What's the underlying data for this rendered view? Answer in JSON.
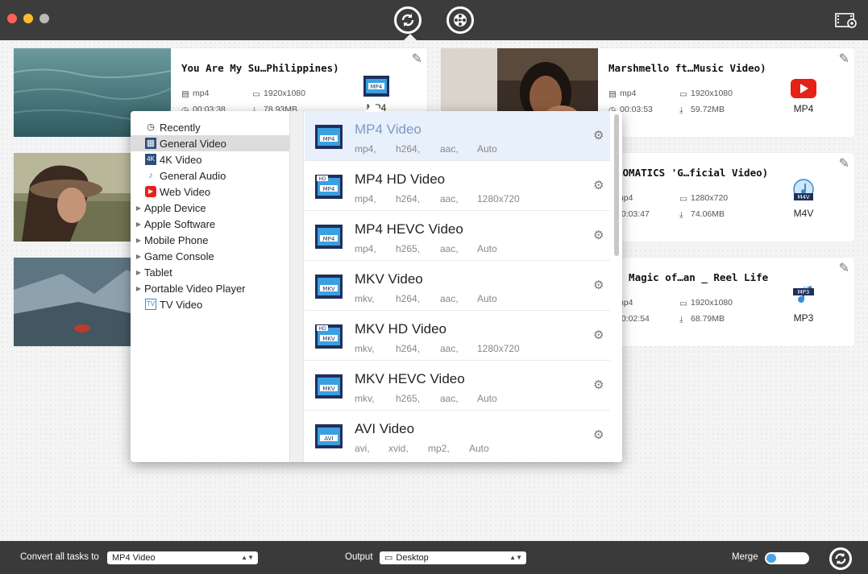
{
  "toolbar": {
    "convert_icon": "convert-refresh-icon",
    "media_icon": "film-reel-icon",
    "settings_icon": "film-settings-icon"
  },
  "tasks": [
    {
      "title": "You Are My Su…Philippines)",
      "container": "mp4",
      "resolution": "1920x1080",
      "duration": "00:03:38",
      "size": "78.93MB",
      "target_format": "MP4",
      "target_icon": "mp4-film-icon"
    },
    {
      "title": "Marshmello ft…Music Video)",
      "container": "mp4",
      "resolution": "1920x1080",
      "duration": "00:03:53",
      "size": "59.72MB",
      "target_format": "MP4",
      "target_icon": "youtube-icon"
    },
    {
      "title": "ROMATICS 'G…ficial Video)",
      "container": "mp4",
      "resolution": "1280x720",
      "duration": "00:03:47",
      "size": "74.06MB",
      "target_format": "M4V",
      "target_icon": "m4v-itunes-icon"
    },
    {
      "title": "e Magic of…an _ Reel Life",
      "container": "mp4",
      "resolution": "1920x1080",
      "duration": "00:02:54",
      "size": "68.79MB",
      "target_format": "MP3",
      "target_icon": "mp3-music-icon"
    }
  ],
  "categories": [
    {
      "label": "Recently",
      "icon": "clock-icon",
      "expandable": false
    },
    {
      "label": "General Video",
      "icon": "film-strip-icon",
      "expandable": false,
      "selected": true
    },
    {
      "label": "4K Video",
      "icon": "4k-film-icon",
      "expandable": false
    },
    {
      "label": "General Audio",
      "icon": "music-note-icon",
      "expandable": false
    },
    {
      "label": "Web Video",
      "icon": "youtube-icon",
      "expandable": false
    },
    {
      "label": "Apple Device",
      "expandable": true
    },
    {
      "label": "Apple Software",
      "expandable": true
    },
    {
      "label": "Mobile Phone",
      "expandable": true
    },
    {
      "label": "Game Console",
      "expandable": true
    },
    {
      "label": "Tablet",
      "expandable": true
    },
    {
      "label": "Portable Video Player",
      "expandable": true
    },
    {
      "label": "TV Video",
      "icon": "tv-icon",
      "expandable": false
    }
  ],
  "formats": [
    {
      "name": "MP4 Video",
      "badge": "MP4",
      "hd": false,
      "specs": [
        "mp4,",
        "h264,",
        "aac,",
        "Auto"
      ],
      "selected": true
    },
    {
      "name": "MP4 HD Video",
      "badge": "MP4",
      "hd": true,
      "specs": [
        "mp4,",
        "h264,",
        "aac,",
        "1280x720"
      ]
    },
    {
      "name": "MP4 HEVC Video",
      "badge": "MP4",
      "hd": false,
      "specs": [
        "mp4,",
        "h265,",
        "aac,",
        "Auto"
      ]
    },
    {
      "name": "MKV Video",
      "badge": "MKV",
      "hd": false,
      "specs": [
        "mkv,",
        "h264,",
        "aac,",
        "Auto"
      ]
    },
    {
      "name": "MKV HD Video",
      "badge": "MKV",
      "hd": true,
      "specs": [
        "mkv,",
        "h264,",
        "aac,",
        "1280x720"
      ]
    },
    {
      "name": "MKV HEVC Video",
      "badge": "MKV",
      "hd": false,
      "specs": [
        "mkv,",
        "h265,",
        "aac,",
        "Auto"
      ]
    },
    {
      "name": "AVI Video",
      "badge": "AVI",
      "hd": false,
      "specs": [
        "avi,",
        "xvid,",
        "mp2,",
        "Auto"
      ]
    }
  ],
  "bottom": {
    "convert_all_label": "Convert all tasks to",
    "convert_all_value": "MP4 Video",
    "output_label": "Output",
    "output_value": "Desktop",
    "merge_label": "Merge",
    "merge_enabled": false
  },
  "colors": {
    "accent": "#4aa3e8",
    "titlebar": "#3c3c3c",
    "selected_row": "#e8f0fb"
  }
}
